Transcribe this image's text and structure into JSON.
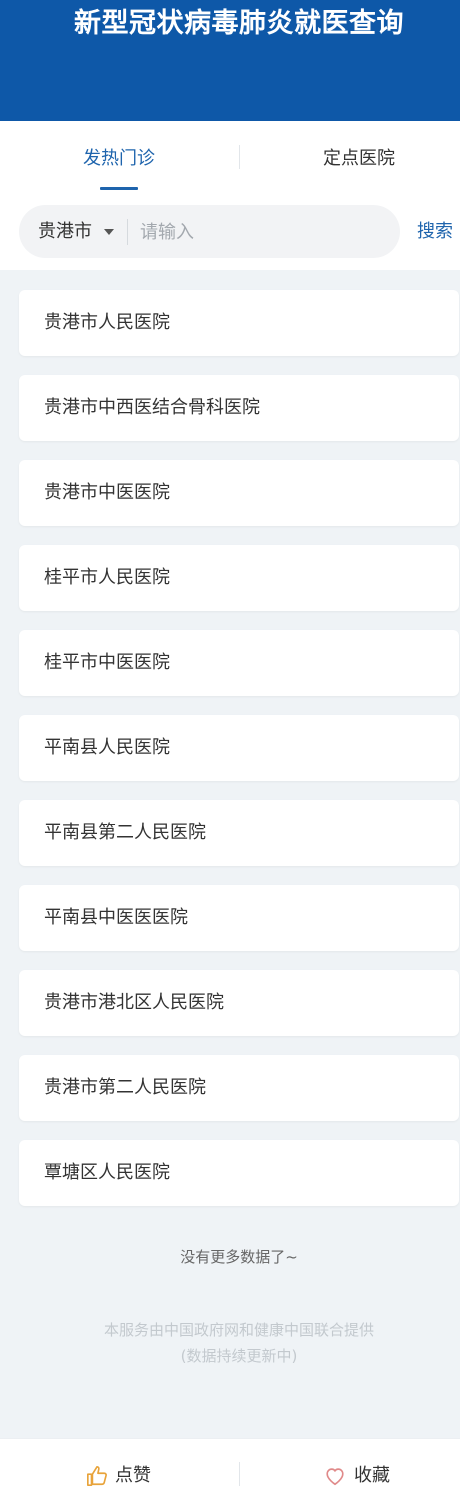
{
  "header": {
    "title": "新型冠状病毒肺炎就医查询"
  },
  "tabs": [
    {
      "label": "发热门诊",
      "active": true
    },
    {
      "label": "定点医院",
      "active": false
    }
  ],
  "search": {
    "city": "贵港市",
    "placeholder": "请输入",
    "value": "",
    "button_label": "搜索"
  },
  "hospitals": [
    "贵港市人民医院",
    "贵港市中西医结合骨科医院",
    "贵港市中医医院",
    "桂平市人民医院",
    "桂平市中医医院",
    "平南县人民医院",
    "平南县第二人民医院",
    "平南县中医医医院",
    "贵港市港北区人民医院",
    "贵港市第二人民医院",
    "覃塘区人民医院"
  ],
  "list_end_text": "没有更多数据了~",
  "footer": {
    "line1": "本服务由中国政府网和健康中国联合提供",
    "line2": "(数据持续更新中)"
  },
  "bottom_bar": {
    "like_label": "点赞",
    "like_icon": "thumbs-up-icon",
    "favorite_label": "收藏",
    "favorite_icon": "heart-icon"
  },
  "colors": {
    "header_bg": "#0e58a8",
    "accent": "#1e64ad",
    "page_bg": "#eff3f6",
    "like_icon": "#e8a33a",
    "heart_icon": "#e08a8a"
  }
}
